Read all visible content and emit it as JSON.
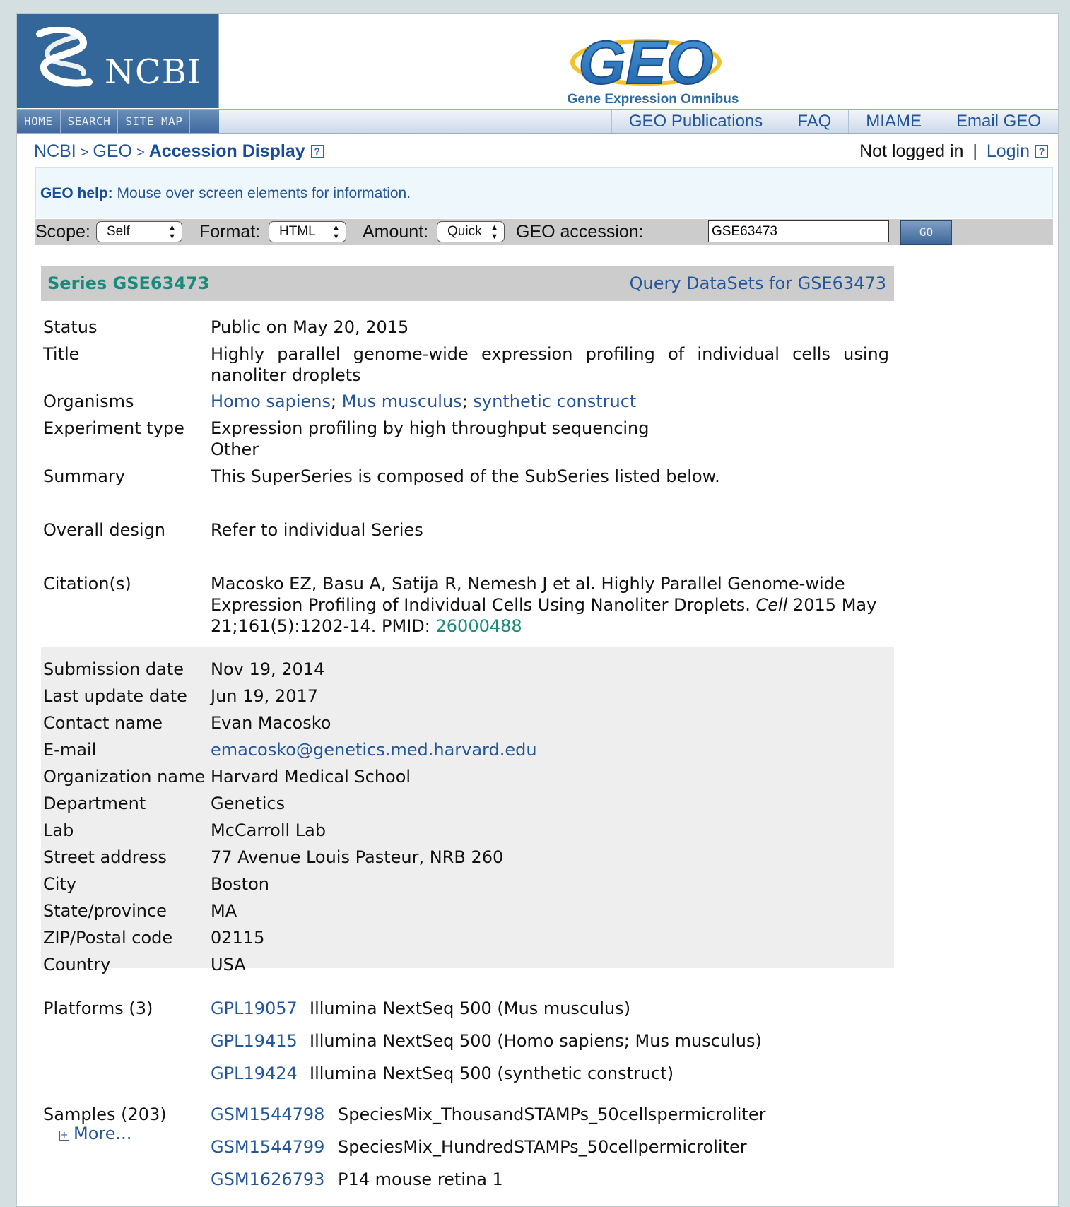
{
  "header": {
    "ncbi_logo_text": "NCBI",
    "geo_logo_text": "GEO",
    "geo_subtitle": "Gene Expression Omnibus",
    "site_links": [
      "HOME",
      "SEARCH",
      "SITE MAP"
    ],
    "geo_links": [
      "GEO Publications",
      "FAQ",
      "MIAME",
      "Email GEO"
    ]
  },
  "breadcrumb": {
    "items": [
      "NCBI",
      "GEO"
    ],
    "separator": ">",
    "current": "Accession Display"
  },
  "login": {
    "status": "Not logged in",
    "separator": "|",
    "login_label": "Login"
  },
  "help": {
    "label": "GEO help:",
    "text": "Mouse over screen elements for information."
  },
  "controls": {
    "scope_label": "Scope:",
    "scope_value": "Self",
    "format_label": "Format:",
    "format_value": "HTML",
    "amount_label": "Amount:",
    "amount_value": "Quick",
    "accession_label": "GEO accession:",
    "accession_value": "GSE63473",
    "go_label": "GO"
  },
  "series": {
    "title": "Series GSE63473",
    "query_link": "Query DataSets for GSE63473",
    "status_label": "Status",
    "status": "Public on May 20, 2015",
    "title_label": "Title",
    "title_text": "Highly parallel genome-wide expression profiling of individual cells using nanoliter droplets",
    "organisms_label": "Organisms",
    "organisms": [
      "Homo sapiens",
      "Mus musculus",
      "synthetic construct"
    ],
    "organisms_sep": ";",
    "experiment_label": "Experiment type",
    "experiment_types": [
      "Expression profiling by high throughput sequencing",
      "Other"
    ],
    "summary_label": "Summary",
    "summary": "This SuperSeries is composed of the SubSeries listed below.",
    "design_label": "Overall design",
    "design": "Refer to individual Series",
    "citation_label": "Citation(s)",
    "citation_line1": "Macosko EZ, Basu A, Satija R, Nemesh J et al. Highly Parallel Genome-wide",
    "citation_line2_pre": "Expression Profiling of Individual Cells Using Nanoliter Droplets. ",
    "citation_journal": "Cell",
    "citation_line2_post": " 2015 May",
    "citation_line3": "21;161(5):1202-14. PMID: ",
    "pmid": "26000488"
  },
  "contact": [
    {
      "label": "Submission date",
      "value": "Nov 19, 2014"
    },
    {
      "label": "Last update date",
      "value": "Jun 19, 2017"
    },
    {
      "label": "Contact name",
      "value": "Evan Macosko"
    },
    {
      "label": "E-mail",
      "value": "emacosko@genetics.med.harvard.edu"
    },
    {
      "label": "Organization name",
      "value": "Harvard Medical School"
    },
    {
      "label": "Department",
      "value": "Genetics"
    },
    {
      "label": "Lab",
      "value": "McCarroll Lab"
    },
    {
      "label": "Street address",
      "value": "77 Avenue Louis Pasteur, NRB 260"
    },
    {
      "label": "City",
      "value": "Boston"
    },
    {
      "label": "State/province",
      "value": "MA"
    },
    {
      "label": "ZIP/Postal code",
      "value": "02115"
    },
    {
      "label": "Country",
      "value": "USA"
    }
  ],
  "platforms": {
    "label": "Platforms (3)",
    "items": [
      {
        "id": "GPL19057",
        "desc": "Illumina NextSeq 500 (Mus musculus)"
      },
      {
        "id": "GPL19415",
        "desc": "Illumina NextSeq 500 (Homo sapiens; Mus musculus)"
      },
      {
        "id": "GPL19424",
        "desc": "Illumina NextSeq 500 (synthetic construct)"
      }
    ]
  },
  "samples": {
    "label": "Samples (203)",
    "more_label": "More...",
    "items": [
      {
        "id": "GSM1544798",
        "desc": "SpeciesMix_ThousandSTAMPs_50cellspermicroliter"
      },
      {
        "id": "GSM1544799",
        "desc": "SpeciesMix_HundredSTAMPs_50cellpermicroliter"
      },
      {
        "id": "GSM1626793",
        "desc": "P14 mouse retina 1"
      }
    ]
  },
  "colors": {
    "ncbi_blue": "#336699",
    "link_blue": "#225599",
    "teal": "#1a8a7a",
    "header_gray": "#cccccc",
    "contact_bg": "#eeeeee",
    "page_bg": "#d3dfe1"
  }
}
